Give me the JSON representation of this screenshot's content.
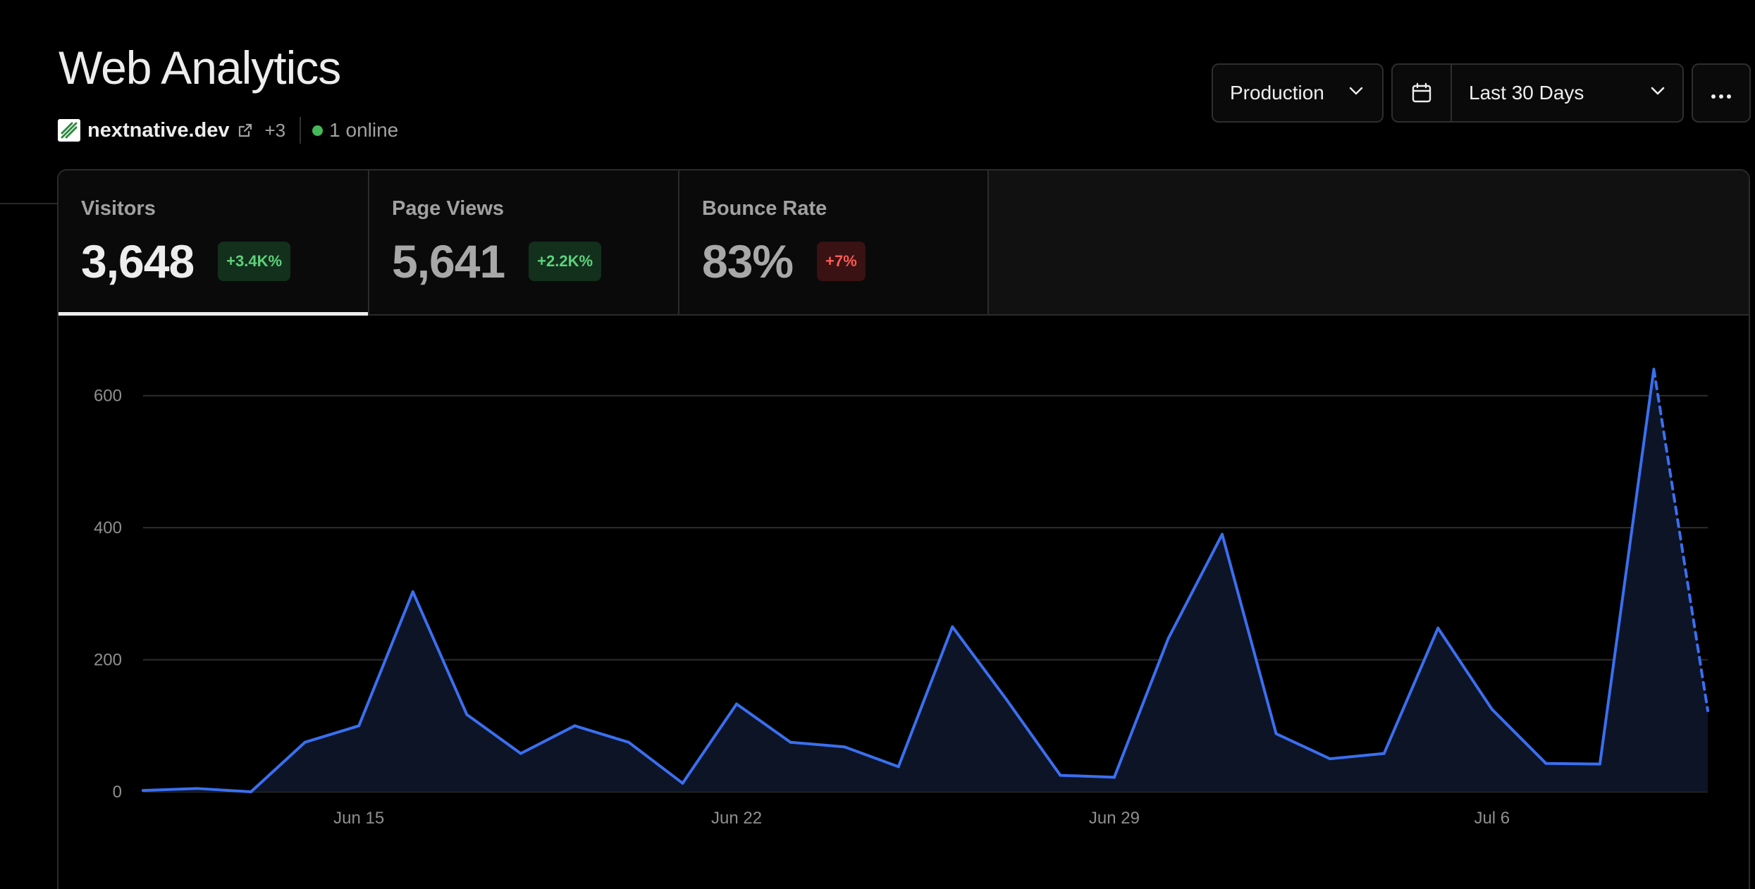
{
  "page": {
    "title": "Web Analytics"
  },
  "site": {
    "name": "nextnative.dev",
    "extra": "+3",
    "online": "1 online"
  },
  "controls": {
    "environment": "Production",
    "date_range": "Last 30 Days"
  },
  "tabs": [
    {
      "label": "Visitors",
      "value": "3,648",
      "change": "+3.4K%",
      "trend": "up",
      "active": true
    },
    {
      "label": "Page Views",
      "value": "5,641",
      "change": "+2.2K%",
      "trend": "up",
      "active": false
    },
    {
      "label": "Bounce Rate",
      "value": "83%",
      "change": "+7%",
      "trend": "down",
      "active": false
    }
  ],
  "colors": {
    "line": "#3b6ff0",
    "up": "#5ed27b",
    "down": "#ff5a54",
    "online": "#45b95a"
  },
  "chart_data": {
    "type": "line",
    "x": [
      "Jun 11",
      "Jun 12",
      "Jun 13",
      "Jun 14",
      "Jun 15",
      "Jun 16",
      "Jun 17",
      "Jun 18",
      "Jun 19",
      "Jun 20",
      "Jun 21",
      "Jun 22",
      "Jun 23",
      "Jun 24",
      "Jun 25",
      "Jun 26",
      "Jun 27",
      "Jun 28",
      "Jun 29",
      "Jun 30",
      "Jul 1",
      "Jul 2",
      "Jul 3",
      "Jul 4",
      "Jul 5",
      "Jul 6",
      "Jul 7",
      "Jul 8",
      "Jul 9",
      "Jul 10"
    ],
    "series": [
      {
        "values": [
          2,
          5,
          0,
          75,
          100,
          303,
          117,
          58,
          100,
          75,
          13,
          133,
          75,
          68,
          38,
          250,
          140,
          25,
          22,
          232,
          390,
          88,
          50,
          58,
          248,
          125,
          43,
          42,
          640,
          123
        ]
      }
    ],
    "projected_last_segment": true,
    "xtick_labels": [
      "Jun 15",
      "Jun 22",
      "Jun 29",
      "Jul 6"
    ],
    "yticks": [
      0,
      200,
      400,
      600
    ],
    "ylim": [
      0,
      700
    ],
    "grid": true
  }
}
